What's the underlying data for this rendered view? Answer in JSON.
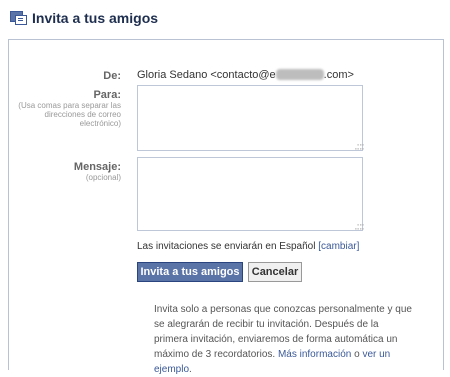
{
  "header": {
    "title": "Invita a tus amigos",
    "icon": "friends-invite-icon"
  },
  "form": {
    "from_label": "De:",
    "from_name": "Gloria Sedano <contacto@e",
    "from_domain_end": ".com>",
    "to_label": "Para:",
    "to_hint": "(Usa comas para separar las direcciones de correo electrónico)",
    "to_value": "",
    "message_label": "Mensaje:",
    "message_hint": "(opcional)",
    "message_value": "",
    "language_text": "Las invitaciones se enviarán en Español ",
    "language_change": "[cambiar]",
    "submit_label": "Invita a tus amigos",
    "cancel_label": "Cancelar"
  },
  "info": {
    "text": "Invita solo a personas que conozcas personalmente y que se alegrarán de recibir tu invitación. Después de la primera invitación, enviaremos de forma automática un máximo de 3 recordatorios. ",
    "more_link": "Más información",
    "or_text": " o ",
    "example_link": "ver un ejemplo",
    "end": "."
  }
}
